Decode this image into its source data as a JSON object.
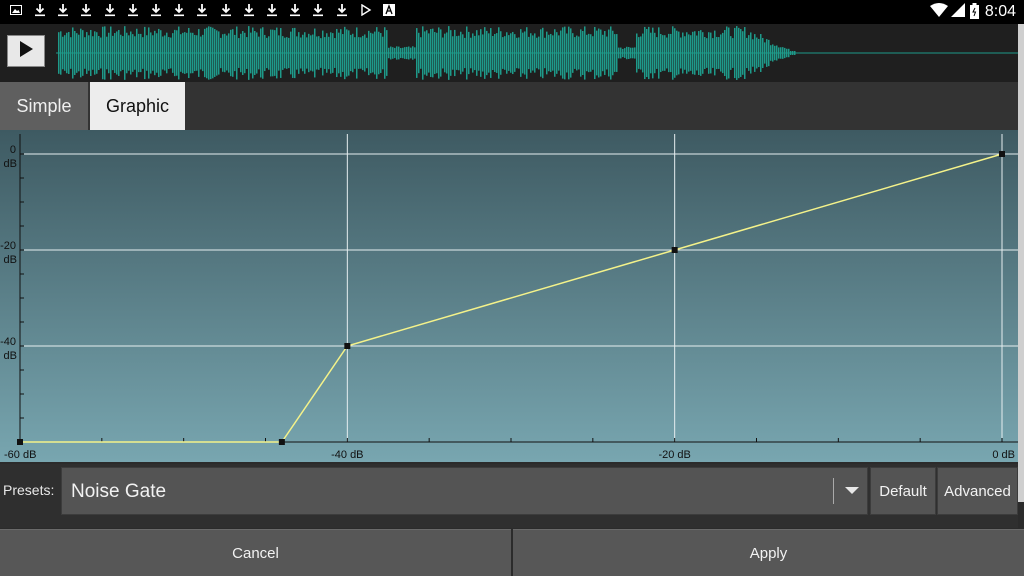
{
  "status_bar": {
    "time": "8:04",
    "notification_icons": [
      "image-icon",
      "download-icon",
      "download-icon",
      "download-icon",
      "download-icon",
      "download-icon",
      "download-icon",
      "download-icon",
      "download-icon",
      "download-icon",
      "download-icon",
      "download-icon",
      "download-icon",
      "download-icon",
      "download-icon",
      "play-store-icon",
      "text-a-icon"
    ]
  },
  "tabs": {
    "simple": "Simple",
    "graphic": "Graphic"
  },
  "graph": {
    "y_labels": [
      {
        "value": "0",
        "unit": "dB"
      },
      {
        "value": "-20",
        "unit": "dB"
      },
      {
        "value": "-40",
        "unit": "dB"
      }
    ],
    "x_labels": [
      "-60 dB",
      "-40 dB",
      "-20 dB",
      "0 dB"
    ],
    "curve_points_db": [
      [
        -60,
        -60
      ],
      [
        -44,
        -60
      ],
      [
        -40,
        -40
      ],
      [
        -20,
        -20
      ],
      [
        0,
        0
      ]
    ],
    "line_color": "#f4f28a"
  },
  "presets": {
    "label": "Presets:",
    "value": "Noise Gate",
    "default_label": "Default",
    "advanced_label": "Advanced"
  },
  "actions": {
    "cancel": "Cancel",
    "apply": "Apply"
  },
  "colors": {
    "waveform": "#1e9a8a"
  }
}
